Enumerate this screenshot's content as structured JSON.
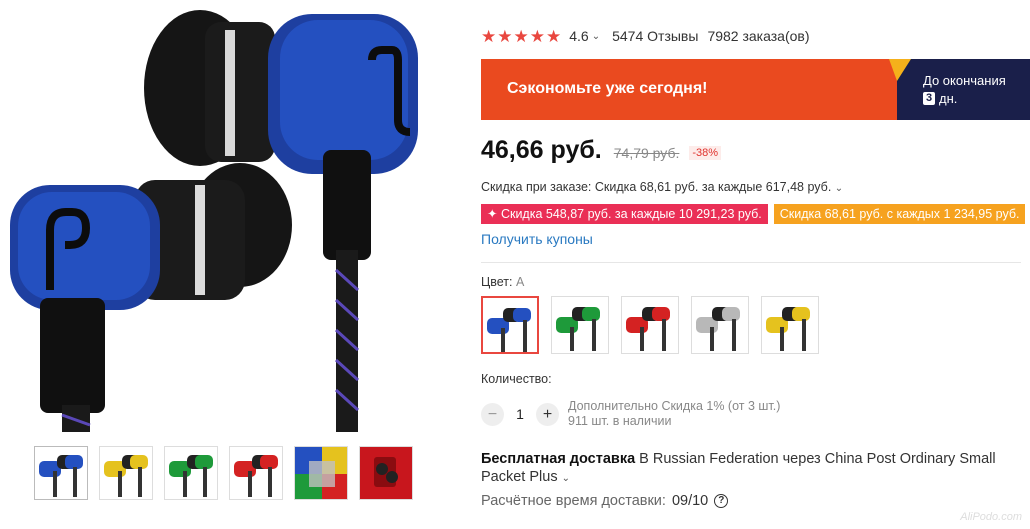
{
  "product": {
    "rating_value": "4.6",
    "reviews": "5474 Отзывы",
    "orders": "7982 заказа(ов)"
  },
  "promo": {
    "text": "Сэкономьте уже сегодня!",
    "countdown_label": "До окончания",
    "days_number": "3",
    "days_unit": "дн."
  },
  "price": {
    "current": "46,66 руб.",
    "old": "74,79 руб.",
    "discount": "-38%"
  },
  "order_discount": "Скидка при заказе: Скидка 68,61 руб. за каждые 617,48 руб.",
  "coupons": [
    "✦ Скидка 548,87 руб. за каждые 10 291,23 руб.",
    "Скидка 68,61 руб. с каждых 1 234,95 руб."
  ],
  "get_coupons": "Получить купоны",
  "color": {
    "label": "Цвет:",
    "selected": "A",
    "options": [
      "blue",
      "green",
      "red",
      "silver",
      "yellow"
    ]
  },
  "quantity": {
    "label": "Количество:",
    "value": "1",
    "minus": "−",
    "plus": "+",
    "extra_discount": "Дополнительно Скидка 1% (от 3 шт.)",
    "stock": "911 шт. в наличии"
  },
  "shipping": {
    "bold": "Бесплатная доставка",
    "text": " В Russian Federation через China Post Ordinary Small Packet Plus"
  },
  "delivery": {
    "label": "Расчётное время доставки:",
    "value": "09/10"
  },
  "watermark": "AliPodo.com",
  "colors": {
    "accent_red": "#e9473f",
    "promo_orange": "#ea4a1f",
    "promo_navy": "#1a1f4a",
    "coupon_pink": "#ea2f56",
    "coupon_orange": "#f6a21f",
    "link_blue": "#2979c1"
  }
}
